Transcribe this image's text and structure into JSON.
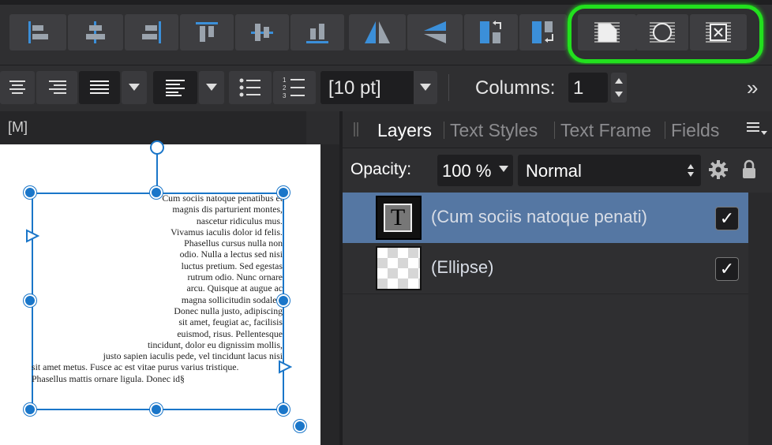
{
  "toolbar": {
    "buttons": [
      "align-left-icon",
      "align-center-horizontal-icon",
      "align-right-icon",
      "align-top-icon",
      "align-center-vertical-icon",
      "align-bottom-icon",
      "flip-horizontal-icon",
      "flip-vertical-icon",
      "rotate-counterclockwise-icon",
      "rotate-clockwise-icon",
      "text-wrap-bounding-box-icon",
      "text-wrap-shape-icon",
      "text-wrap-none-icon"
    ]
  },
  "text_toolbar": {
    "font_size": "[10 pt]",
    "columns_label": "Columns:",
    "columns_value": "1",
    "more_icon": "»"
  },
  "document": {
    "tab_label": "[M]",
    "frame_text": [
      "Cum sociis natoque penatibus et",
      "magnis dis parturient montes,",
      "nascetur ridiculus mus.",
      "Vivamus iaculis dolor id felis.",
      "Phasellus cursus nulla non",
      "odio. Nulla a lectus sed nisi",
      "luctus pretium. Sed egestas",
      "rutrum odio. Nunc ornare",
      "arcu. Quisque at augue ac",
      "magna sollicitudin sodales.",
      "Donec nulla justo, adipiscing",
      "sit amet, feugiat ac, facilisis",
      "euismod, risus. Pellentesque",
      "tincidunt, dolor eu dignissim mollis,",
      "justo sapien iaculis pede, vel tincidunt lacus nisi",
      "sit amet metus. Fusce ac est vitae purus varius tristique.",
      "Phasellus mattis ornare ligula. Donec id§"
    ]
  },
  "panel": {
    "tabs": [
      "Layers",
      "Text Styles",
      "Text Frame",
      "Fields"
    ],
    "active_tab": "Layers",
    "opacity_label": "Opacity:",
    "opacity_value": "100 %",
    "blend_mode": "Normal",
    "layers": [
      {
        "name": "(Cum sociis natoque penati)",
        "thumb": "T",
        "checked": "✓"
      },
      {
        "name": "(Ellipse)",
        "thumb": "",
        "checked": "✓"
      }
    ]
  },
  "colors": {
    "accent_blue": "#1a76c9",
    "selection_row": "#5577a3",
    "highlight_green": "#22e01e",
    "toolbar_bg": "#2f2f31"
  }
}
